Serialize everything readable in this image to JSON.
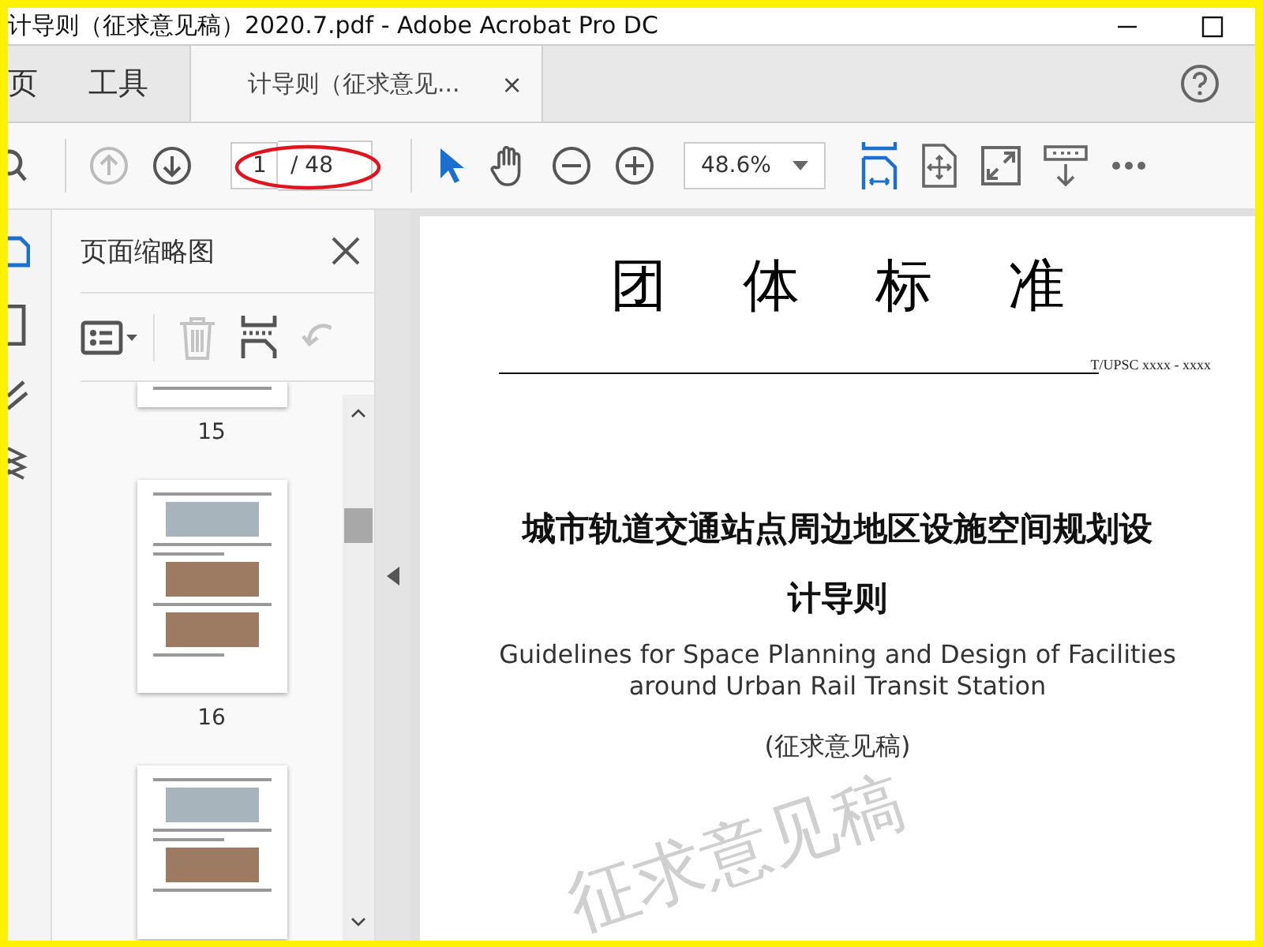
{
  "window": {
    "title": "计导则（征求意见稿）2020.7.pdf - Adobe Acrobat Pro DC"
  },
  "tabs": [
    {
      "kind": "nav",
      "label": "页",
      "selected": false
    },
    {
      "kind": "nav",
      "label": "工具",
      "selected": false
    },
    {
      "kind": "document",
      "label": "计导则（征求意见...",
      "close": "×",
      "selected": true
    }
  ],
  "toolbar": {
    "nav_buttons": [
      {
        "kind": "up",
        "disabled": true
      },
      {
        "kind": "down",
        "disabled": false
      }
    ],
    "page_field": {
      "value": "1",
      "total": "/ 48"
    },
    "tools": [
      {
        "kind": "select",
        "selected": true
      },
      {
        "kind": "hand",
        "selected": false
      }
    ],
    "zoom_field": {
      "value": "48.6%"
    },
    "view_tools": [
      {
        "kind": "fit",
        "selected": true
      },
      {
        "kind": "move",
        "selected": false
      },
      {
        "kind": "fullscreen",
        "selected": false
      },
      {
        "kind": "download",
        "selected": false
      }
    ]
  },
  "side_icons": [
    {
      "kind": "pages",
      "selected": true
    },
    {
      "kind": "bookmark",
      "selected": false
    },
    {
      "kind": "attachment",
      "selected": false
    },
    {
      "kind": "layers",
      "selected": false
    }
  ],
  "thumbnail_panel": {
    "title": "页面缩略图",
    "tools": [
      {
        "kind": "options",
        "disabled": false
      },
      {
        "kind": "delete",
        "disabled": true
      },
      {
        "kind": "insert",
        "disabled": false
      },
      {
        "kind": "undo",
        "disabled": true
      }
    ],
    "pages": [
      {
        "kind": "tail",
        "label": "15"
      },
      {
        "kind": "full",
        "label": "16"
      },
      {
        "kind": "head"
      }
    ]
  },
  "document": {
    "heading": "团体标准",
    "code": "T/UPSC  xxxx - xxxx",
    "title_zh_lines": [
      "城市轨道交通站点周边地区设施空间规划设",
      "计导则"
    ],
    "title_en_lines": [
      "Guidelines for Space Planning and Design of Facilities",
      "around Urban Rail Transit Station"
    ],
    "draft_note": "(征求意见稿)",
    "watermark": "征求意见稿"
  }
}
